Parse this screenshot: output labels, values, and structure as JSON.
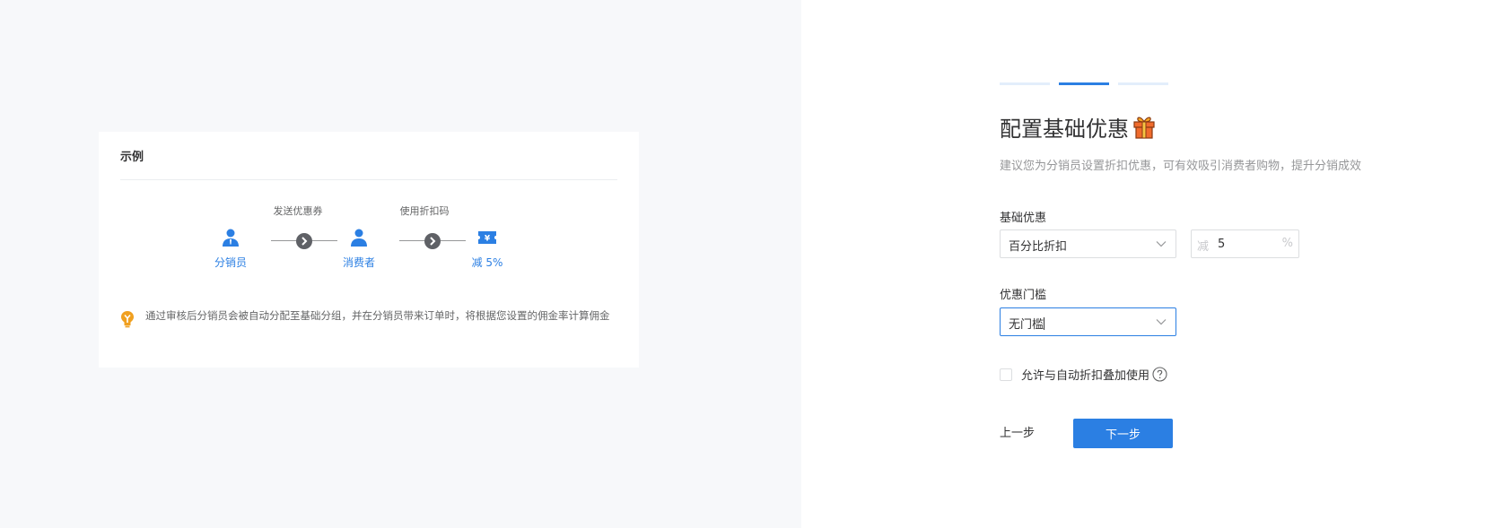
{
  "example": {
    "title": "示例",
    "flow": {
      "nodes": [
        {
          "label": "分销员",
          "icon": "user-icon"
        },
        {
          "label": "消费者",
          "icon": "user-icon"
        },
        {
          "label": "减 5%",
          "icon": "coupon-icon"
        }
      ],
      "steps": [
        {
          "label": "发送优惠券"
        },
        {
          "label": "使用折扣码"
        }
      ]
    },
    "tip": "通过审核后分销员会被自动分配至基础分组，并在分销员带来订单时，将根据您设置的佣金率计算佣金"
  },
  "wizard": {
    "progress": {
      "total": 3,
      "current": 2
    },
    "title": "配置基础优惠",
    "title_icon": "gift-icon",
    "subtitle": "建议您为分销员设置折扣优惠，可有效吸引消费者购物，提升分销成效",
    "basic_discount": {
      "label": "基础优惠",
      "type_value": "百分比折扣",
      "amount_prefix": "减",
      "amount_value": "5",
      "amount_suffix": "%"
    },
    "threshold": {
      "label": "优惠门槛",
      "value": "无门槛"
    },
    "stack_option": {
      "label": "允许与自动折扣叠加使用",
      "checked": false
    },
    "buttons": {
      "prev": "上一步",
      "next": "下一步"
    }
  },
  "colors": {
    "primary": "#2b7fe3",
    "progress_inactive": "#e3eefb",
    "tip_icon": "#f0a020",
    "panel_bg": "#f7f8fa"
  }
}
